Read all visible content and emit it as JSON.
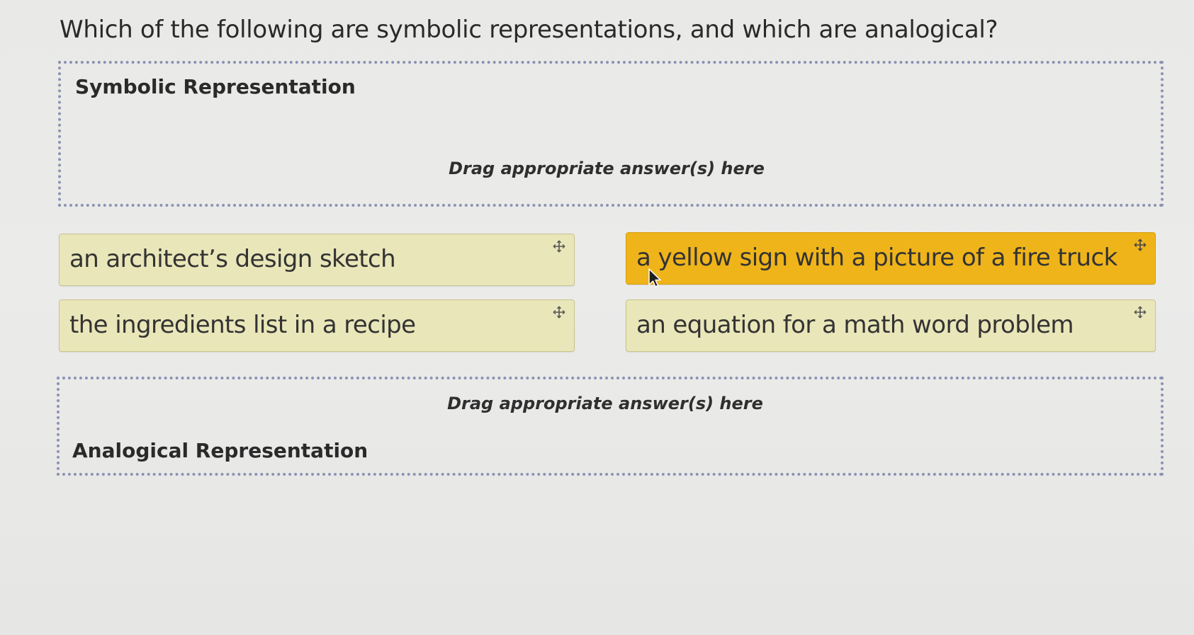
{
  "question": "Which of the following are symbolic representations, and which are analogical?",
  "zones": {
    "symbolic": {
      "title": "Symbolic Representation",
      "hint": "Drag appropriate answer(s) here"
    },
    "analogical": {
      "title": "Analogical Representation",
      "hint": "Drag appropriate answer(s) here"
    }
  },
  "answers": [
    {
      "label": "an architect’s design sketch",
      "icon": "move-icon",
      "state": "idle"
    },
    {
      "label": "a yellow sign with a picture of a fire truck",
      "icon": "move-icon",
      "state": "active"
    },
    {
      "label": "the ingredients list in a recipe",
      "icon": "move-icon",
      "state": "idle"
    },
    {
      "label": "an equation for a math word problem",
      "icon": "move-icon",
      "state": "idle"
    }
  ],
  "colors": {
    "card_idle": "#e9e6b9",
    "card_active": "#efb41a",
    "dropzone_border": "#8a93b3"
  }
}
